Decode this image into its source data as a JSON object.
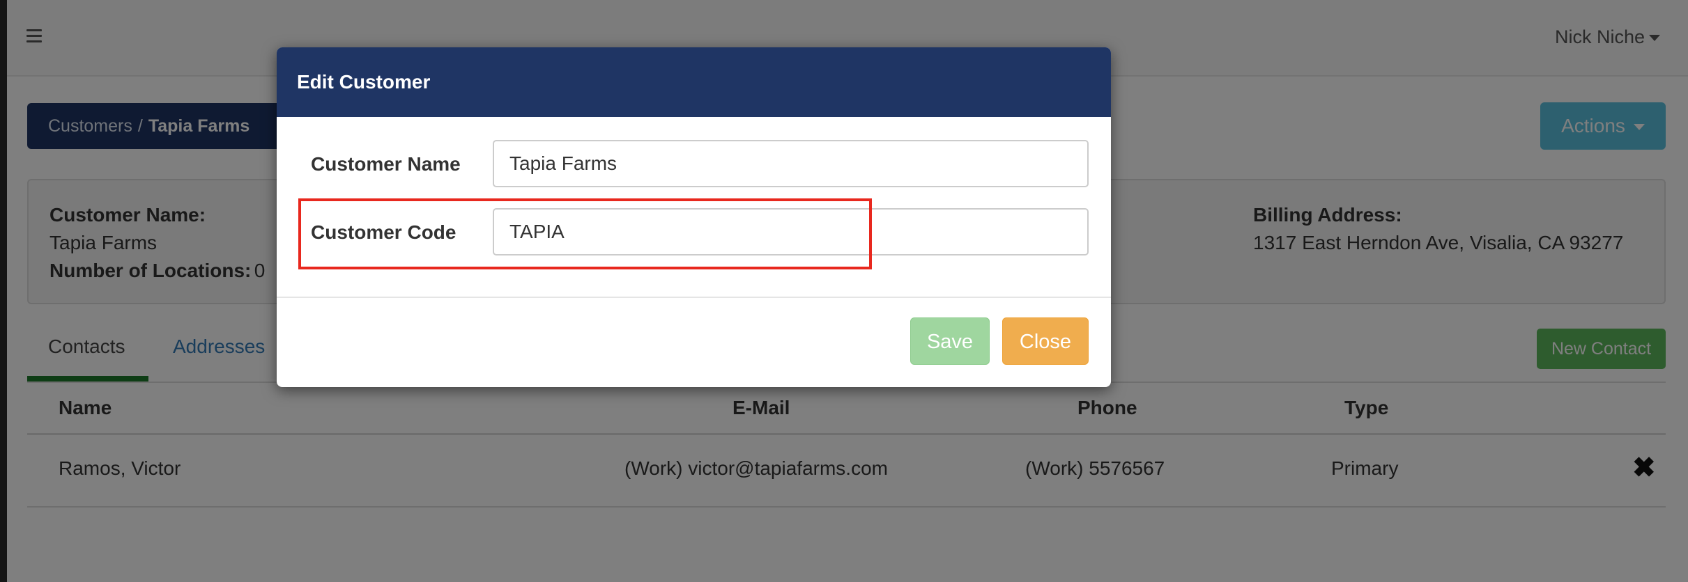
{
  "topbar": {
    "user_name": "Nick Niche"
  },
  "breadcrumb": {
    "parent": "Customers",
    "separator": "/",
    "current": "Tapia Farms"
  },
  "actions": {
    "label": "Actions"
  },
  "customer_info": {
    "name_label": "Customer Name:",
    "name_value": "Tapia Farms",
    "locations_label": "Number of Locations:",
    "locations_value": "0",
    "billing_label": "Billing Address:",
    "billing_value": "1317 East Herndon Ave, Visalia, CA 93277"
  },
  "tabs": [
    {
      "label": "Contacts",
      "active": true
    },
    {
      "label": "Addresses",
      "active": false
    }
  ],
  "new_contact": {
    "label": "New Contact"
  },
  "table": {
    "columns": [
      "Name",
      "E-Mail",
      "Phone",
      "Type"
    ],
    "rows": [
      {
        "name": "Ramos, Victor",
        "email": "(Work) victor@tapiafarms.com",
        "phone": "(Work) 5576567",
        "type": "Primary"
      }
    ]
  },
  "modal": {
    "title": "Edit Customer",
    "fields": [
      {
        "label": "Customer Name",
        "value": "Tapia Farms"
      },
      {
        "label": "Customer Code",
        "value": "TAPIA"
      }
    ],
    "save_label": "Save",
    "close_label": "Close"
  },
  "colors": {
    "header_navy": "#1f3564",
    "highlight_red": "#e8281e",
    "save_green": "#9fd69f",
    "close_orange": "#f0ad4e",
    "actions_blue": "#5bc0de",
    "new_contact_green": "#5cb85c"
  },
  "icons": {
    "menu": "hamburger-icon",
    "dropdown": "caret-down-icon",
    "delete": "close-x-icon"
  }
}
